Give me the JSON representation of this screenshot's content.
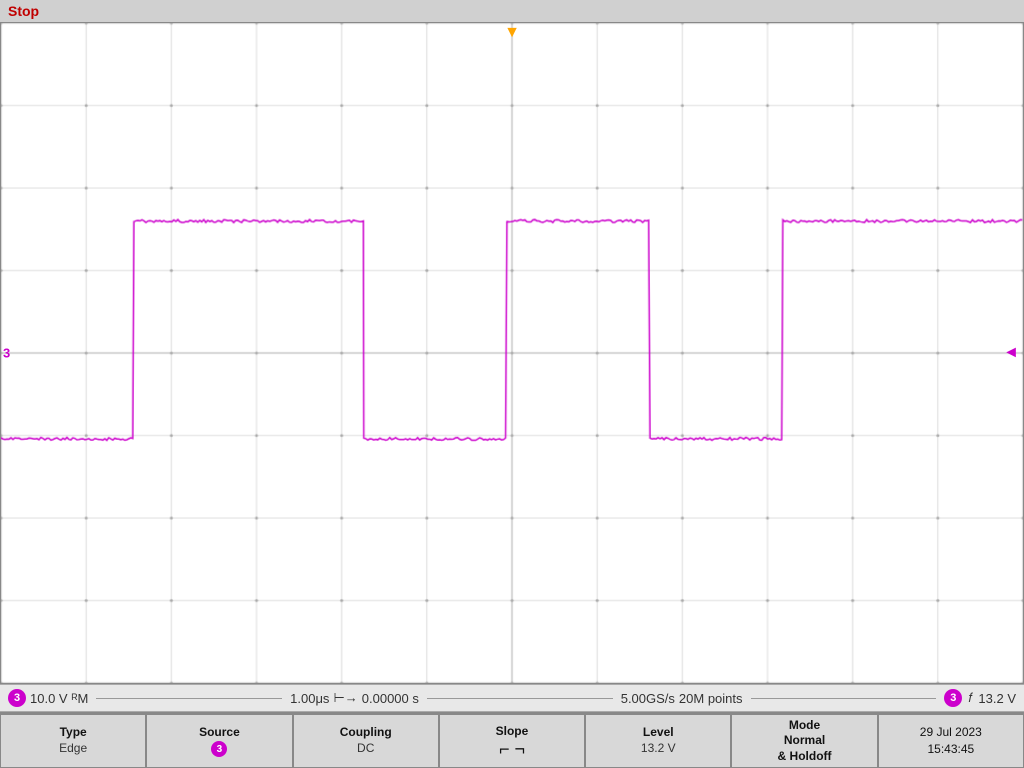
{
  "status": {
    "state": "Stop"
  },
  "display": {
    "ch3_label": "3",
    "right_marker": "◄"
  },
  "measurement_bar": {
    "ch_badge": "3",
    "volts_div": "10.0 V",
    "coupling_symbol": "ᴿM",
    "time_div": "1.00μs",
    "time_offset_label": "⊢→",
    "time_offset": "0.00000 s",
    "sample_rate": "5.00GS/s",
    "sample_points": "20M points",
    "trig_ch_badge": "3",
    "trig_slope": "𝑓",
    "trig_level": "13.2 V"
  },
  "controls": {
    "type_label": "Type",
    "type_value": "Edge",
    "source_label": "Source",
    "source_ch": "3",
    "coupling_label": "Coupling",
    "coupling_value": "DC",
    "slope_label": "Slope",
    "level_label": "Level",
    "level_value": "13.2 V",
    "mode_label": "Mode",
    "mode_value": "Normal",
    "mode_sub": "& Holdoff",
    "date": "29 Jul 2023",
    "time": "15:43:45"
  }
}
